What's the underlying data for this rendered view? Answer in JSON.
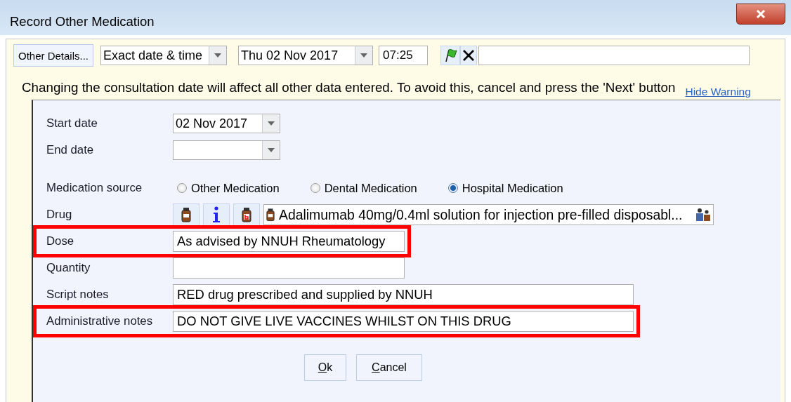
{
  "window": {
    "title": "Record Other Medication"
  },
  "toolbar": {
    "other_details_button": "Other Details...",
    "date_mode": "Exact date & time",
    "date": "Thu 02 Nov 2017",
    "time": "07:25"
  },
  "warning": {
    "message": "Changing the consultation date will affect all other data entered. To avoid this, cancel and press the 'Next' button",
    "link": "Hide Warning"
  },
  "form": [
    {
      "kind": "combo",
      "label": "Start date",
      "value": "02 Nov 2017",
      "highlighted": false
    },
    {
      "kind": "combo",
      "label": "End date",
      "highlighted": false
    },
    {
      "kind": "radio",
      "label": "Medication source",
      "options": [
        {
          "label": "Other Medication",
          "selected": false
        },
        {
          "label": "Dental Medication",
          "selected": false
        },
        {
          "label": "Hospital Medication",
          "selected": true
        }
      ],
      "highlighted": false
    },
    {
      "kind": "drug",
      "label": "Drug",
      "value": "Adalimumab 40mg/0.4ml solution for injection pre-filled disposabl...",
      "highlighted": false
    },
    {
      "kind": "short",
      "label": "Dose",
      "value": "As advised by NNUH Rheumatology",
      "highlighted": true
    },
    {
      "kind": "short",
      "label": "Quantity",
      "highlighted": false
    },
    {
      "kind": "long",
      "label": "Script notes",
      "value": "RED drug prescribed and supplied by NNUH",
      "highlighted": false
    },
    {
      "kind": "long",
      "label": "Administrative notes",
      "value": "DO NOT GIVE LIVE VACCINES WHILST ON THIS DRUG",
      "highlighted": true
    }
  ],
  "buttons": [
    "Ok",
    "Cancel"
  ]
}
